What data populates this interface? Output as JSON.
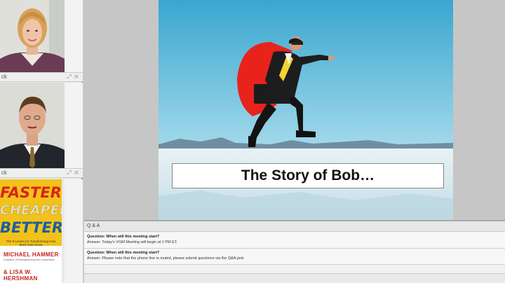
{
  "presenters": [
    {
      "label": "ck",
      "controls": "⤢ ✕"
    },
    {
      "label": "ck",
      "controls": "⤢ ✕"
    }
  ],
  "book": {
    "line1": "FASTER",
    "line2": "CHEAPER",
    "line3": "BETTER",
    "subtitle": "The 9 Levers for Transforming How Work Gets Done",
    "author1": "MICHAEL HAMMER",
    "author1_note": "Coauthor of Reengineering the Corporation",
    "author2": "& LISA W. HERSHMAN"
  },
  "slide": {
    "title": "The Story of Bob…"
  },
  "qa": {
    "header": "Q & A",
    "items": [
      {
        "question": "Question: When will this meeting start?",
        "answer": "Answer: Today's VGM Meeting will begin at 1 PM ET."
      },
      {
        "question": "Question: When will this meeting start?",
        "answer": "Answer: Please note that the phone line is muted, please submit questions via the Q&A pod."
      }
    ]
  },
  "colors": {
    "book_yellow": "#f2c21b",
    "book_red": "#d8231c",
    "book_blue": "#1b5f9e",
    "sky": "#57b6d8",
    "cape": "#e8231c"
  }
}
